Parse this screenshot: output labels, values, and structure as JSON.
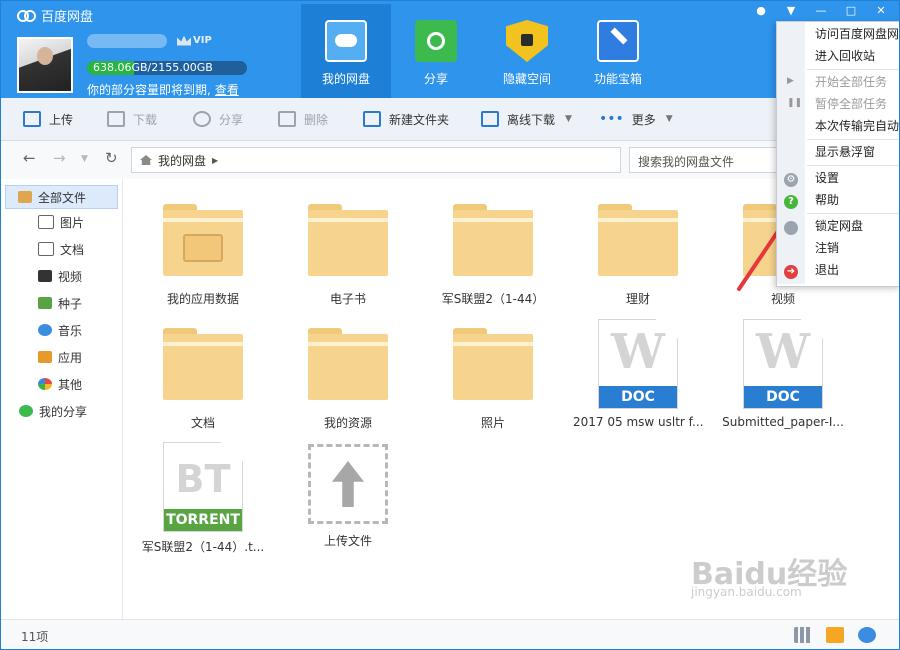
{
  "app": {
    "title": "百度网盘"
  },
  "user": {
    "quota_text": "638.06GB/2155.00GB",
    "quota_used_fraction": 0.296,
    "vip_label": "VIP"
  },
  "quota_note": {
    "text": "你的部分容量即将到期,",
    "link": "查看"
  },
  "nav_tabs": [
    {
      "label": "我的网盘",
      "icon": "cloud-drive-icon",
      "active": true
    },
    {
      "label": "分享",
      "icon": "share-icon",
      "active": false
    },
    {
      "label": "隐藏空间",
      "icon": "lock-shield-icon",
      "active": false
    },
    {
      "label": "功能宝箱",
      "icon": "toolbox-icon",
      "active": false
    }
  ],
  "toolbar": {
    "upload": "上传",
    "download": "下载",
    "share": "分享",
    "delete": "删除",
    "new_folder": "新建文件夹",
    "offline_download": "离线下载",
    "more": "更多"
  },
  "address": {
    "path": "我的网盘",
    "search_placeholder": "搜索我的网盘文件"
  },
  "sidebar": {
    "all_files": "全部文件",
    "items": [
      "图片",
      "文档",
      "视频",
      "种子",
      "音乐",
      "应用",
      "其他"
    ],
    "my_share": "我的分享"
  },
  "files": [
    {
      "name": "我的应用数据",
      "type": "folder-app"
    },
    {
      "name": "电子书",
      "type": "folder"
    },
    {
      "name": "军S联盟2（1-44）",
      "type": "folder"
    },
    {
      "name": "理财",
      "type": "folder"
    },
    {
      "name": "视频",
      "type": "folder"
    },
    {
      "name": "文档",
      "type": "folder"
    },
    {
      "name": "我的资源",
      "type": "folder"
    },
    {
      "name": "照片",
      "type": "folder"
    },
    {
      "name": "2017 05 msw usltr f...",
      "type": "doc",
      "badge": "DOC"
    },
    {
      "name": "Submitted_paper-I...",
      "type": "doc",
      "badge": "DOC"
    },
    {
      "name": "军S联盟2（1-44）.t...",
      "type": "torrent",
      "badge": "TORRENT",
      "big_label": "BT"
    },
    {
      "name": "上传文件",
      "type": "upload"
    }
  ],
  "doc_letter": "W",
  "status": {
    "count": "11项"
  },
  "menu": {
    "items": [
      {
        "label": "访问百度网盘网站",
        "enabled": true
      },
      {
        "label": "进入回收站",
        "enabled": true
      },
      {
        "label": "开始全部任务",
        "enabled": false
      },
      {
        "label": "暂停全部任务",
        "enabled": false
      },
      {
        "label": "本次传输完自动关机",
        "enabled": true
      },
      {
        "label": "显示悬浮窗",
        "enabled": true
      },
      {
        "label": "设置",
        "enabled": true
      },
      {
        "label": "帮助",
        "enabled": true
      },
      {
        "label": "锁定网盘",
        "enabled": true
      },
      {
        "label": "注销",
        "enabled": true
      },
      {
        "label": "退出",
        "enabled": true
      }
    ]
  },
  "colors": {
    "header": "#2e94ec",
    "accent": "#1e7fd6",
    "folder": "#f6d48d",
    "doc_band": "#2a7ed2",
    "torrent_band": "#58a443",
    "annotation": "#e8353a"
  },
  "watermark": {
    "main": "Baidu经验",
    "sub": "jingyan.baidu.com"
  }
}
